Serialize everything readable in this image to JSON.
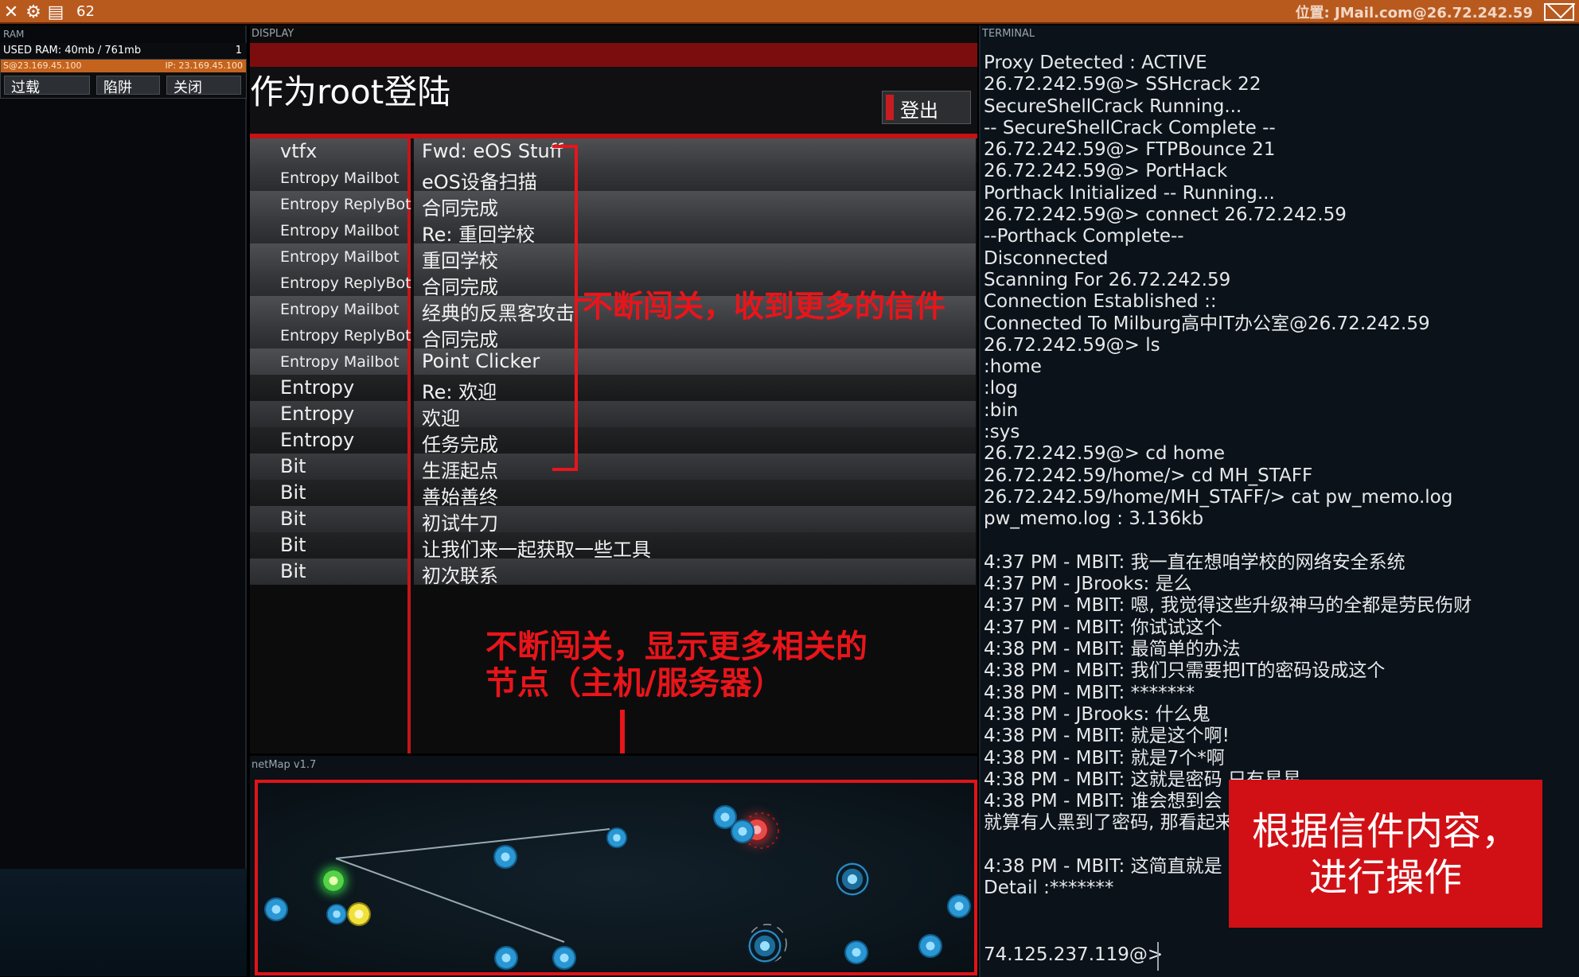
{
  "topbar": {
    "count": "62",
    "location": "位置: JMail.com@26.72.242.59",
    "icons": [
      "close-icon",
      "gear-icon",
      "save-icon",
      "mail-icon"
    ]
  },
  "ram": {
    "header": "RAM",
    "used": "USED RAM: 40mb / 761mb",
    "used_count": "1",
    "proc_left": "S@23.169.45.100",
    "proc_ip": "IP: 23.169.45.100",
    "btn_filter": "过载",
    "btn_trap": "陷阱",
    "btn_close": "关闭"
  },
  "display": {
    "header": "DISPLAY",
    "title": "作为root登陆",
    "logout": "登出"
  },
  "mails": [
    {
      "sender": "vtfx",
      "subject": "Fwd: eOS Stuff"
    },
    {
      "sender": "Entropy Mailbot",
      "subject": "eOS设备扫描"
    },
    {
      "sender": "Entropy ReplyBot",
      "subject": "合同完成"
    },
    {
      "sender": "Entropy Mailbot",
      "subject": "Re: 重回学校"
    },
    {
      "sender": "Entropy Mailbot",
      "subject": "重回学校"
    },
    {
      "sender": "Entropy ReplyBot",
      "subject": "合同完成"
    },
    {
      "sender": "Entropy Mailbot",
      "subject": "经典的反黑客攻击"
    },
    {
      "sender": "Entropy ReplyBot",
      "subject": "合同完成"
    },
    {
      "sender": "Entropy Mailbot",
      "subject": "Point Clicker"
    },
    {
      "sender": "Entropy",
      "subject": "Re: 欢迎"
    },
    {
      "sender": "Entropy",
      "subject": "欢迎"
    },
    {
      "sender": "Entropy",
      "subject": "任务完成"
    },
    {
      "sender": "Bit",
      "subject": "生涯起点"
    },
    {
      "sender": "Bit",
      "subject": "善始善终"
    },
    {
      "sender": "Bit",
      "subject": "初试牛刀"
    },
    {
      "sender": "Bit",
      "subject": "让我们来一起获取一些工具"
    },
    {
      "sender": "Bit",
      "subject": "初次联系"
    }
  ],
  "annotations": {
    "mail_note": "不断闯关，收到更多的信件",
    "node_note_line1": "不断闯关，显示更多相关的",
    "node_note_line2": "节点（主机/服务器）",
    "action_line1": "根据信件内容，",
    "action_line2": "进行操作"
  },
  "netmap": {
    "header": "netMap v1.7"
  },
  "terminal": {
    "header": "TERMINAL",
    "lines": [
      "Proxy Detected : ACTIVE",
      "26.72.242.59@> SSHcrack 22",
      "SecureShellCrack Running...",
      "-- SecureShellCrack Complete --",
      "26.72.242.59@> FTPBounce 21",
      "26.72.242.59@> PortHack",
      "Porthack Initialized -- Running...",
      "26.72.242.59@> connect 26.72.242.59",
      "--Porthack Complete--",
      "Disconnected",
      "Scanning For 26.72.242.59",
      "Connection Established ::",
      "Connected To Milburg高中IT办公室@26.72.242.59",
      "26.72.242.59@> ls",
      ":home",
      ":log",
      ":bin",
      ":sys",
      "26.72.242.59@> cd home",
      "26.72.242.59/home/> cd MH_STAFF",
      "26.72.242.59/home/MH_STAFF/> cat pw_memo.log",
      "pw_memo.log : 3.136kb",
      "",
      "4:37 PM - MBIT: 我一直在想咱学校的网络安全系统",
      "4:37 PM - JBrooks: 是么",
      "4:37 PM - MBIT: 嗯, 我觉得这些升级神马的全都是劳民伤财",
      "4:37 PM - MBIT: 你试试这个",
      "4:38 PM - MBIT: 最简单的办法",
      "4:38 PM - MBIT: 我们只需要把IT的密码设成这个",
      "4:38 PM - MBIT: *******",
      "4:38 PM - JBrooks: 什么鬼",
      "4:38 PM - MBIT: 就是这个啊!",
      "4:38 PM - MBIT: 就是7个*啊",
      "4:38 PM - MBIT: 这就是密码 只有星星",
      "4:38 PM - MBIT: 谁会想到会",
      "就算有人黑到了密码, 那看起来",
      "",
      "4:38 PM - MBIT: 这简直就是",
      "Detail :*******"
    ],
    "prompt": "74.125.237.119@>"
  }
}
